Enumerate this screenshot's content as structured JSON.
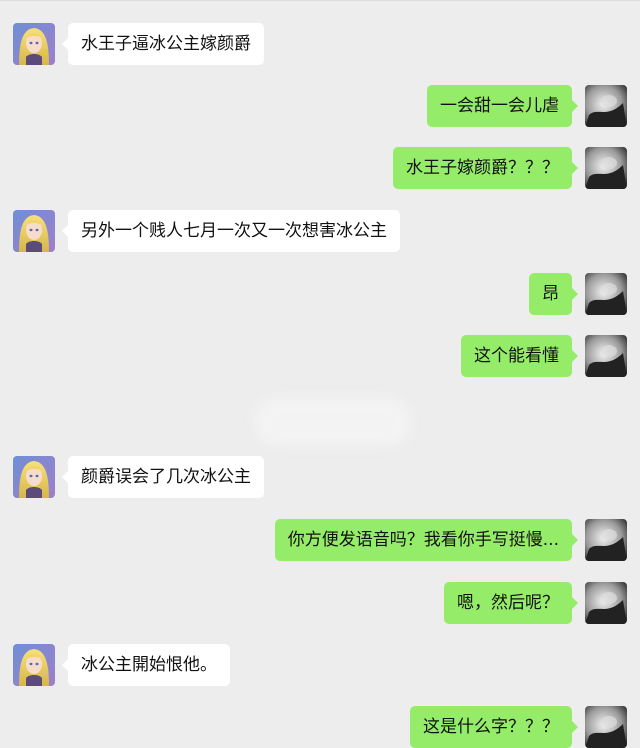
{
  "chat": {
    "messages": [
      {
        "side": "in",
        "text": "水王子逼冰公主嫁颜爵"
      },
      {
        "side": "out",
        "text": "一会甜一会儿虐"
      },
      {
        "side": "out",
        "text": "水王子嫁颜爵？？？"
      },
      {
        "side": "in",
        "text": "另外一个贱人七月一次又一次想害冰公主"
      },
      {
        "side": "out",
        "text": "昂"
      },
      {
        "side": "out",
        "text": "这个能看懂"
      },
      {
        "side": "in",
        "text": "颜爵误会了几次冰公主"
      },
      {
        "side": "out",
        "text": "你方便发语音吗？我看你手写挺慢..."
      },
      {
        "side": "out",
        "text": "嗯，然后呢？"
      },
      {
        "side": "in",
        "text": "冰公主開始恨他。"
      },
      {
        "side": "out",
        "text": "这是什么字？？？"
      }
    ]
  },
  "colors": {
    "background": "#ededed",
    "incoming_bubble": "#ffffff",
    "outgoing_bubble": "#95ec69"
  }
}
